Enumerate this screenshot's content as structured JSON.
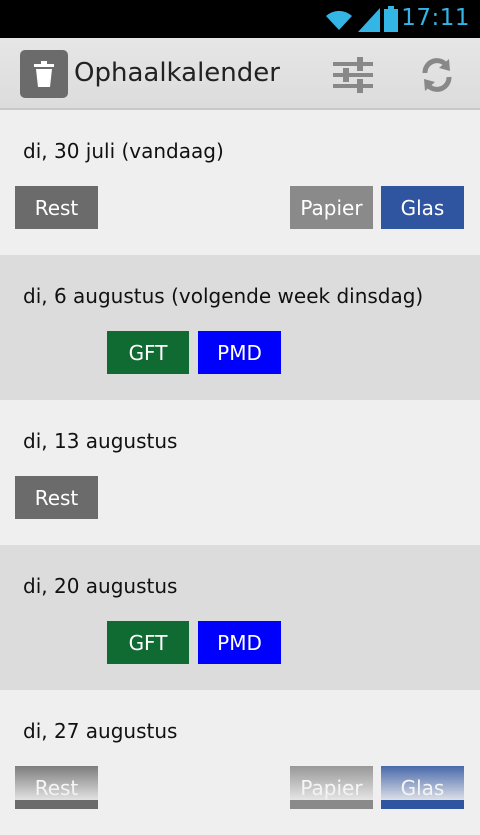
{
  "status_bar": {
    "time": "17:11",
    "icons": [
      "wifi-icon",
      "signal-icon",
      "battery-icon"
    ]
  },
  "action_bar": {
    "title": "Ophaalkalender",
    "icons": [
      "trash-icon",
      "settings-sliders-icon",
      "refresh-icon"
    ]
  },
  "colors": {
    "rest": "#6b6b6b",
    "papier": "#8a8a8a",
    "glas": "#2f54a0",
    "gft": "#0f6b32",
    "pmd": "#0000ff",
    "accent": "#33b5e5"
  },
  "days": [
    {
      "date": "di, 30 juli (vandaag)",
      "chips": [
        "Rest",
        "Papier",
        "Glas"
      ]
    },
    {
      "date": "di, 6 augustus (volgende week dinsdag)",
      "chips": [
        "GFT",
        "PMD"
      ]
    },
    {
      "date": "di, 13 augustus",
      "chips": [
        "Rest"
      ]
    },
    {
      "date": "di, 20 augustus",
      "chips": [
        "GFT",
        "PMD"
      ]
    },
    {
      "date": "di, 27 augustus",
      "chips": [
        "Rest",
        "Papier",
        "Glas"
      ]
    }
  ]
}
